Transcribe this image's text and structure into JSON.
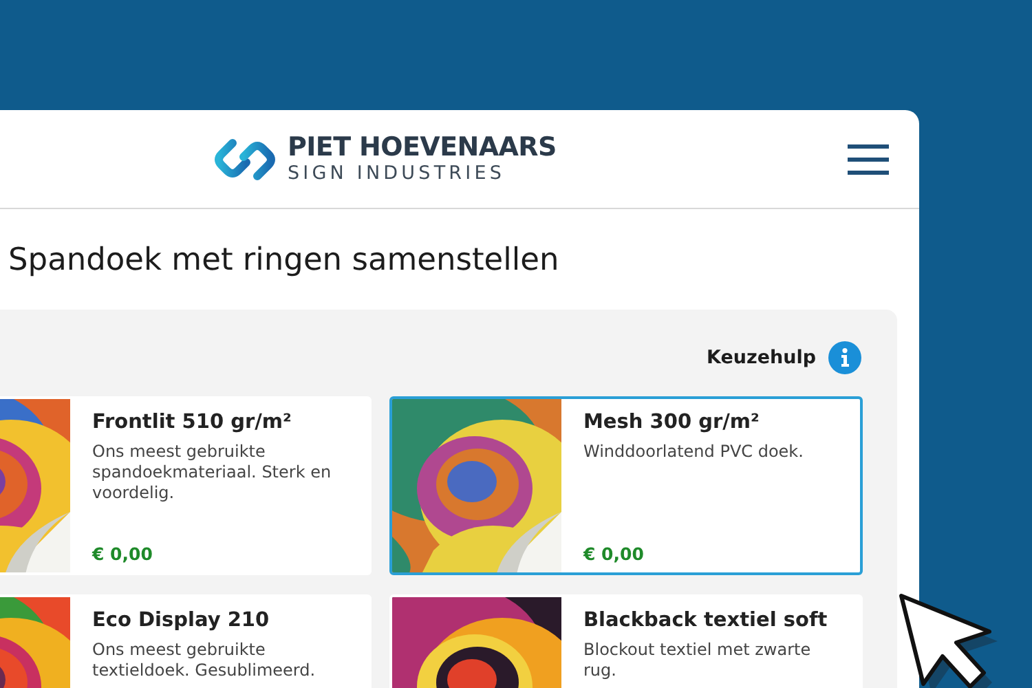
{
  "header": {
    "brand_name": "PIET HOEVENAARS",
    "brand_tagline": "SIGN INDUSTRIES"
  },
  "page_title": "Spandoek met ringen samenstellen",
  "help": {
    "label": "Keuzehulp"
  },
  "products": [
    {
      "name": "Frontlit 510 gr/m²",
      "description": "Ons meest gebruikte spandoekmateriaal. Sterk en voordelig.",
      "price": "€ 0,00",
      "selected": false
    },
    {
      "name": "Mesh 300 gr/m²",
      "description": "Winddoorlatend PVC doek.",
      "price": "€ 0,00",
      "selected": true
    },
    {
      "name": "Eco Display 210",
      "description": "Ons meest gebruikte textieldoek. Gesublimeerd.",
      "selected": false
    },
    {
      "name": "Blackback textiel soft",
      "description": "Blockout textiel met zwarte rug.",
      "selected": false
    }
  ]
}
